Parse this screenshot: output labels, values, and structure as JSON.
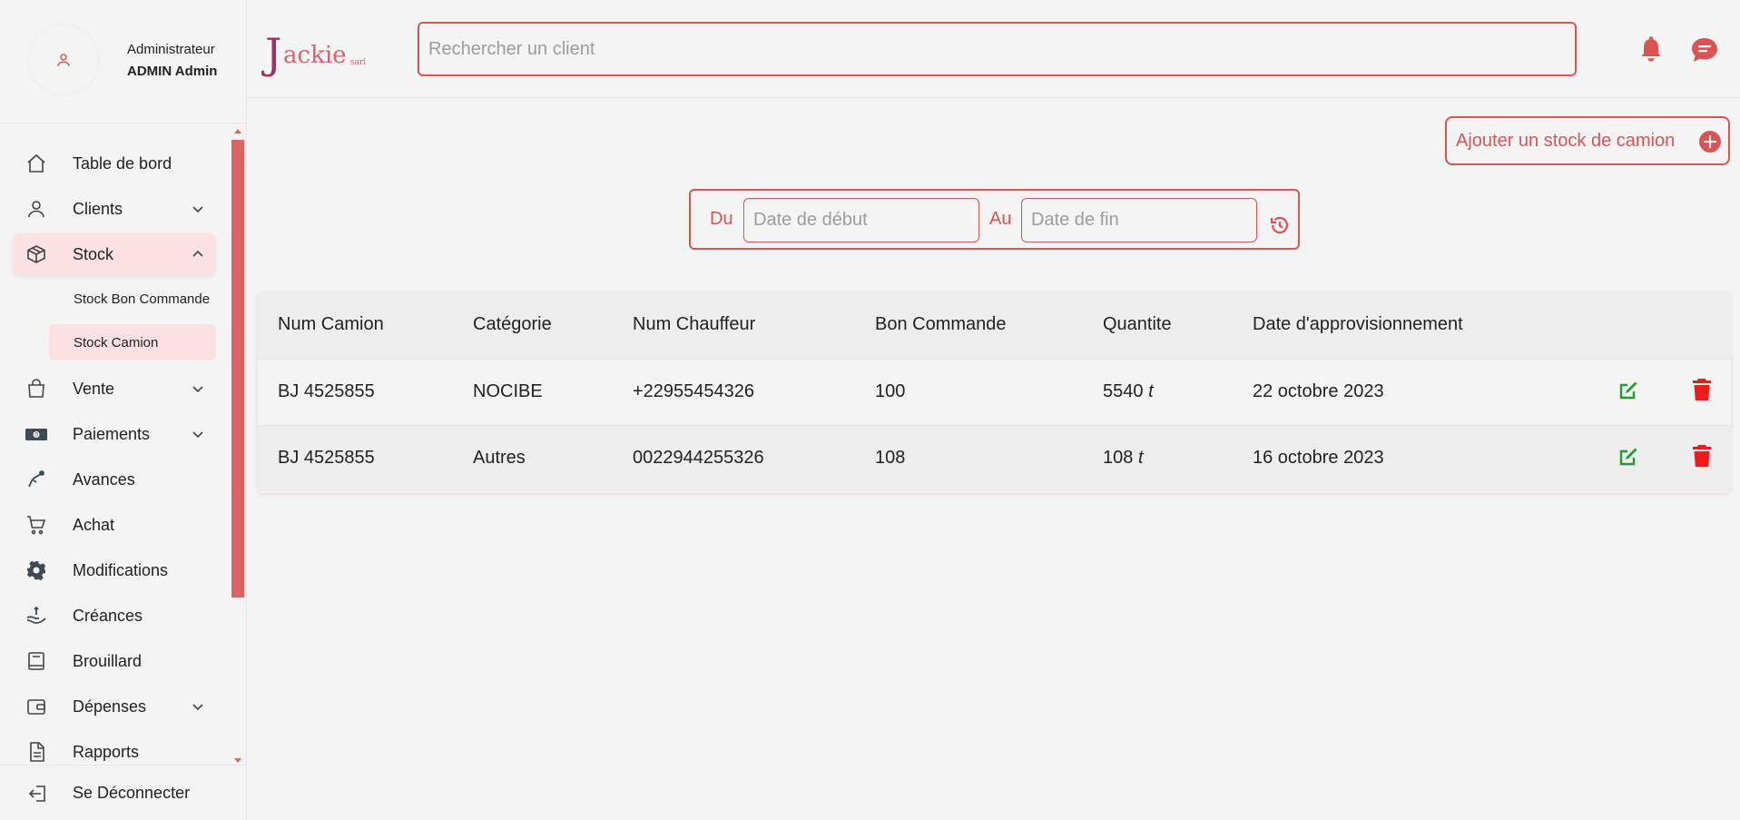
{
  "profile": {
    "role": "Administrateur",
    "name": "ADMIN Admin"
  },
  "sidebar": {
    "items": [
      {
        "label": "Table de bord",
        "icon": "home-icon"
      },
      {
        "label": "Clients",
        "icon": "user-icon"
      },
      {
        "label": "Stock",
        "icon": "box-icon"
      },
      {
        "label": "Stock Bon Commande"
      },
      {
        "label": "Stock Camion"
      },
      {
        "label": "Vente",
        "icon": "shopping-bag-icon"
      },
      {
        "label": "Paiements",
        "icon": "money-icon"
      },
      {
        "label": "Avances",
        "icon": "hand-coin-icon"
      },
      {
        "label": "Achat",
        "icon": "cart-icon"
      },
      {
        "label": "Modifications",
        "icon": "gear-icon"
      },
      {
        "label": "Créances",
        "icon": "hand-money-icon"
      },
      {
        "label": "Brouillard",
        "icon": "book-icon"
      },
      {
        "label": "Dépenses",
        "icon": "wallet-icon"
      },
      {
        "label": "Rapports",
        "icon": "document-icon"
      }
    ],
    "logout": "Se Déconnecter"
  },
  "header": {
    "logo": {
      "j": "J",
      "rest": "ackie",
      "sarl": "sarl"
    },
    "search_placeholder": "Rechercher un client"
  },
  "main": {
    "add_button": "Ajouter un stock de camion",
    "filter": {
      "from_label": "Du",
      "from_placeholder": "Date de début",
      "to_label": "Au",
      "to_placeholder": "Date de fin"
    },
    "table": {
      "columns": [
        "Num Camion",
        "Catégorie",
        "Num Chauffeur",
        "Bon Commande",
        "Quantite",
        "Date d'approvisionnement"
      ],
      "rows": [
        {
          "camion": "BJ 4525855",
          "categorie": "NOCIBE",
          "chauffeur": "+22955454326",
          "bon": "100",
          "quantite": "5540",
          "unit": "t",
          "date": "22 octobre 2023"
        },
        {
          "camion": "BJ 4525855",
          "categorie": "Autres",
          "chauffeur": "0022944255326",
          "bon": "108",
          "quantite": "108",
          "unit": "t",
          "date": "16 octobre 2023"
        }
      ]
    }
  },
  "colors": {
    "accent": "#d95555",
    "active_bg": "#fbe1e1",
    "edit": "#1f9d2f",
    "delete": "#ee1b1b"
  }
}
